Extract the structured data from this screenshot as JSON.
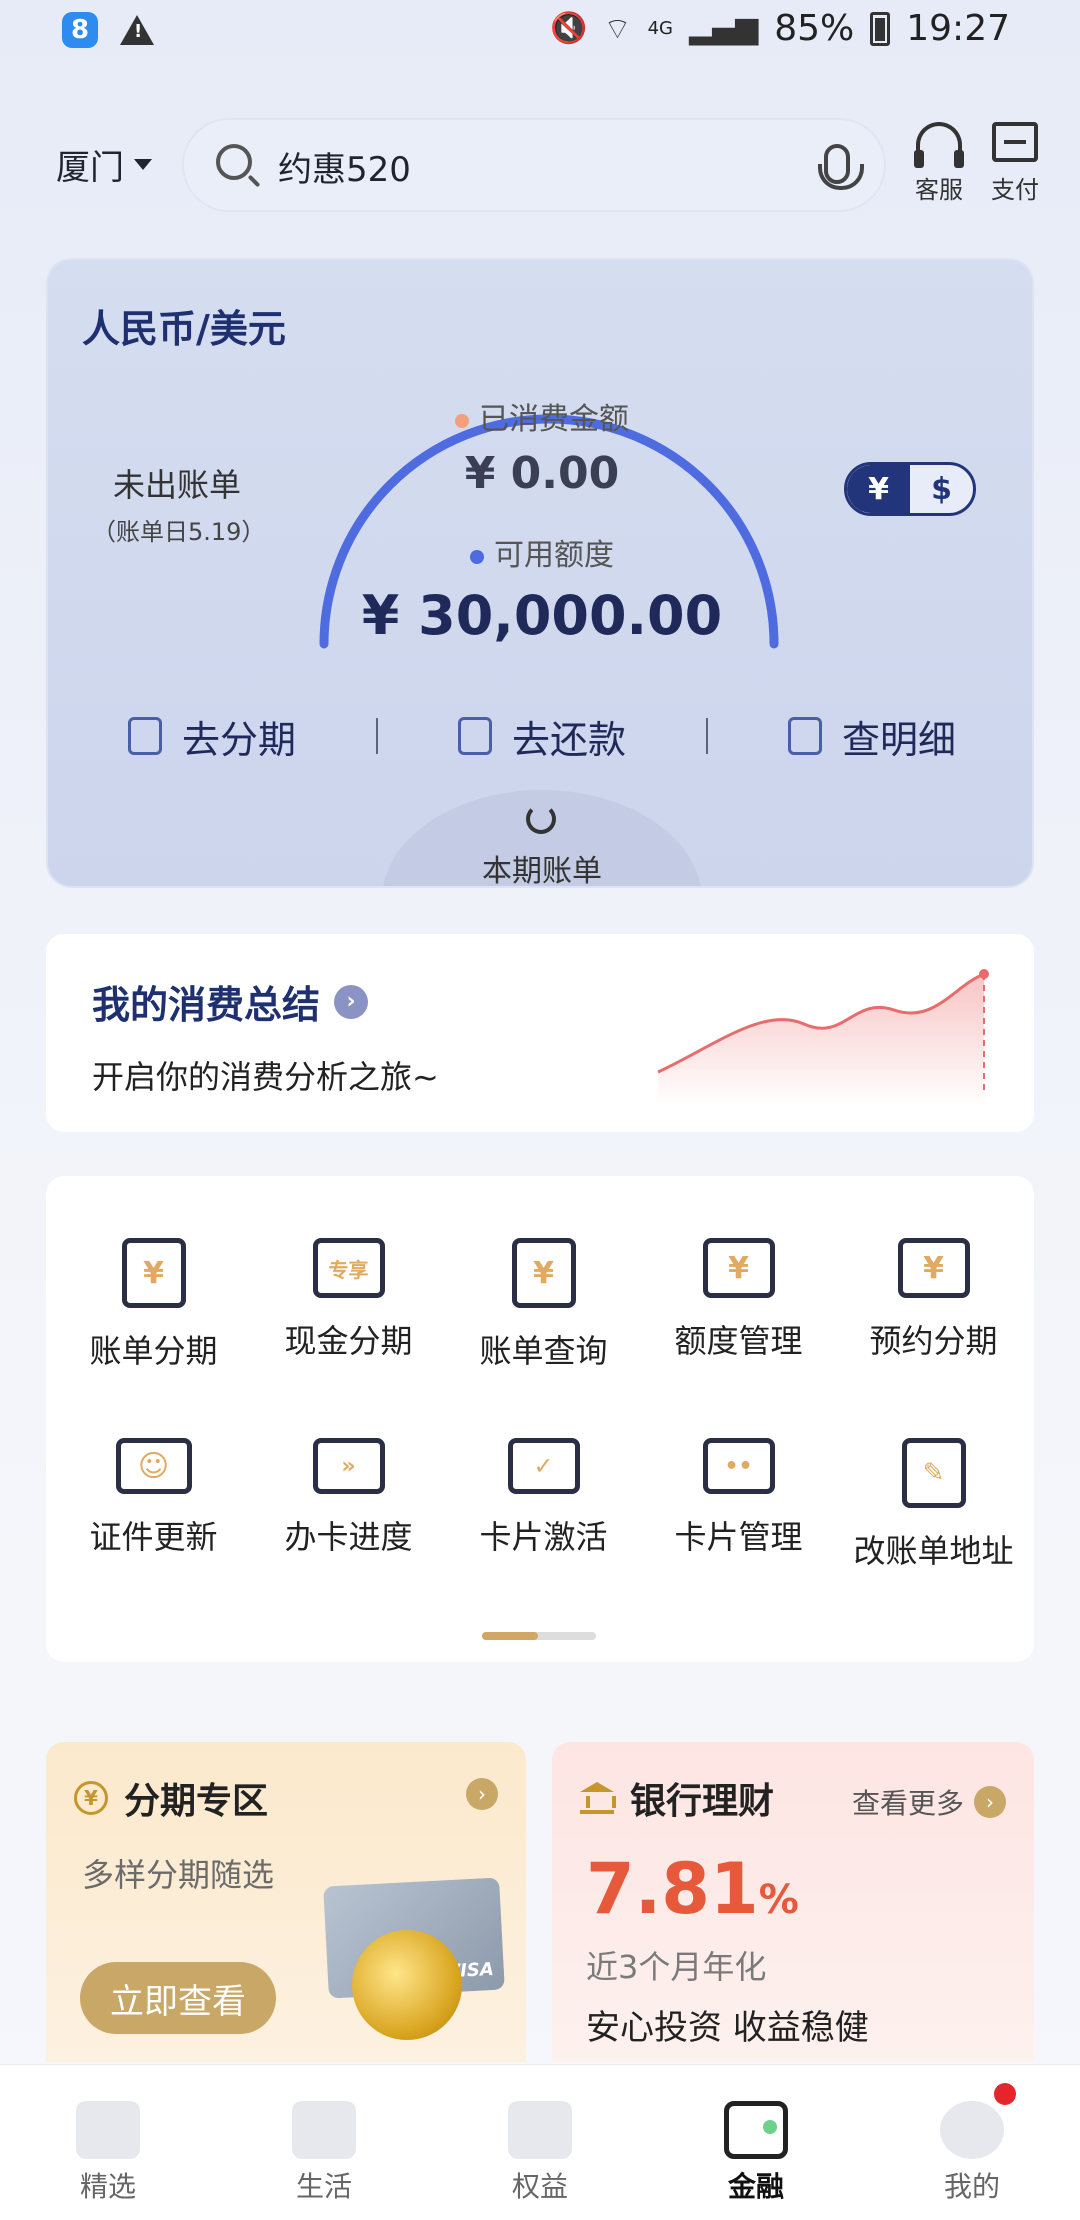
{
  "status_bar": {
    "battery": "85%",
    "time": "19:27",
    "network": "4G"
  },
  "header": {
    "city": "厦门",
    "search_text": "约惠520",
    "service_label": "客服",
    "pay_label": "支付"
  },
  "card": {
    "title": "人民币/美元",
    "unbilled_label": "未出账单",
    "bill_date": "（账单日5.19）",
    "consumed_label": "已消费金额",
    "consumed_value": "¥ 0.00",
    "available_label": "可用额度",
    "available_value": "¥ 30,000.00",
    "currency_options": [
      "¥",
      "$"
    ],
    "actions": [
      "去分期",
      "去还款",
      "查明细"
    ],
    "bill_tab": "本期账单",
    "colors": {
      "consumed_dot": "#f4a07a",
      "available_dot": "#4f6be0",
      "arc": "#4f6be0"
    }
  },
  "summary": {
    "title": "我的消费总结",
    "subtitle": "开启你的消费分析之旅~"
  },
  "menu": {
    "row1": [
      "账单分期",
      "现金分期",
      "账单查询",
      "额度管理",
      "预约分期"
    ],
    "row2": [
      "证件更新",
      "办卡进度",
      "卡片激活",
      "卡片管理",
      "改账单地址"
    ],
    "icon_glyphs": {
      "cash": "专享"
    }
  },
  "promo_installment": {
    "title": "分期专区",
    "subtitle": "多样分期随选",
    "button": "立即查看"
  },
  "promo_wealth": {
    "title": "银行理财",
    "see_more": "查看更多",
    "rate": "7.81",
    "rate_unit": "%",
    "rate_label": "近3个月年化",
    "slogan": "安心投资 收益稳健"
  },
  "bottom_nav": {
    "items": [
      "精选",
      "生活",
      "权益",
      "金融",
      "我的"
    ],
    "active": "金融"
  }
}
